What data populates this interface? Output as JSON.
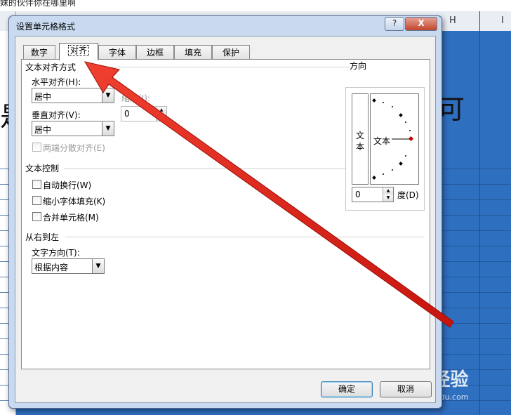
{
  "background": {
    "top_text": "妹的伙伴你在哪里啊",
    "columns": [
      "H",
      "I"
    ],
    "big_glyphs": [
      "是",
      "可"
    ],
    "watermark": "Bai 经验",
    "watermark_sub": "jingyan.baidu.com"
  },
  "dialog": {
    "title": "设置单元格格式",
    "help_label": "?",
    "close_label": "X",
    "tabs": [
      "数字",
      "对齐",
      "字体",
      "边框",
      "填充",
      "保护"
    ],
    "active_tab": "对齐",
    "text_align_group": "文本对齐方式",
    "horizontal_label": "水平对齐(H):",
    "horizontal_value": "居中",
    "indent_label": "缩进(I):",
    "indent_value": "0",
    "vertical_label": "垂直对齐(V):",
    "vertical_value": "居中",
    "justify_distributed": "两端分散对齐(E)",
    "text_control_group": "文本控制",
    "wrap_text": "自动换行(W)",
    "shrink_to_fit": "缩小字体填充(K)",
    "merge_cells": "合并单元格(M)",
    "rtl_group": "从右到左",
    "text_direction_label": "文字方向(T):",
    "text_direction_value": "根据内容",
    "orientation_group": "方向",
    "orientation_vertical_text": [
      "文",
      "本"
    ],
    "orientation_dial_text": "文本",
    "degree_value": "0",
    "degree_label": "度(D)",
    "ok_button": "确定",
    "cancel_button": "取消"
  },
  "annotation": {
    "color": "#e8201a",
    "meaning": "arrow pointing to 对齐 tab"
  }
}
